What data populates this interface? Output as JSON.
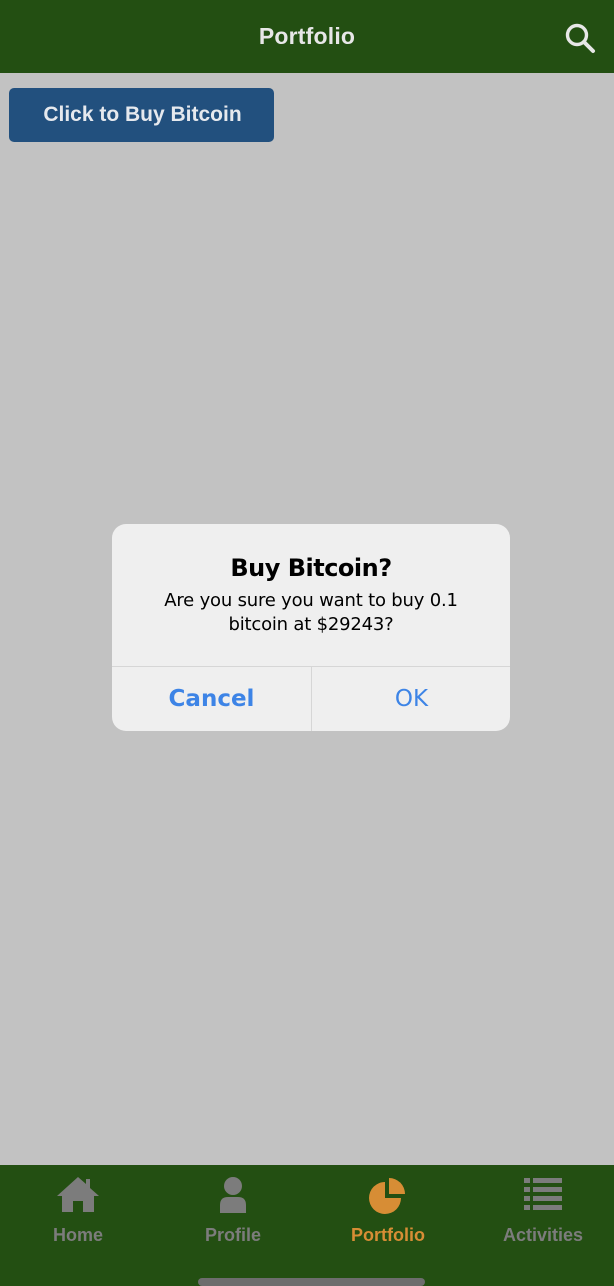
{
  "header": {
    "title": "Portfolio",
    "search_icon": "search-icon"
  },
  "main": {
    "buy_button_label": "Click to Buy Bitcoin"
  },
  "alert": {
    "title": "Buy Bitcoin?",
    "message_line1": "Are you sure you want to buy 0.1",
    "message_line2": "bitcoin at $29243?",
    "cancel_label": "Cancel",
    "ok_label": "OK"
  },
  "tabbar": {
    "tabs": [
      {
        "label": "Home",
        "icon": "home-icon",
        "active": false
      },
      {
        "label": "Profile",
        "icon": "person-icon",
        "active": false
      },
      {
        "label": "Portfolio",
        "icon": "pie-chart-icon",
        "active": true
      },
      {
        "label": "Activities",
        "icon": "list-icon",
        "active": false
      }
    ]
  },
  "colors": {
    "header_bg": "#234f12",
    "backdrop": "#c2c2c2",
    "buy_button_bg": "#22507e",
    "alert_button_text": "#3d84e6",
    "tab_active": "#d78d35",
    "tab_inactive": "#7c7c7c"
  }
}
